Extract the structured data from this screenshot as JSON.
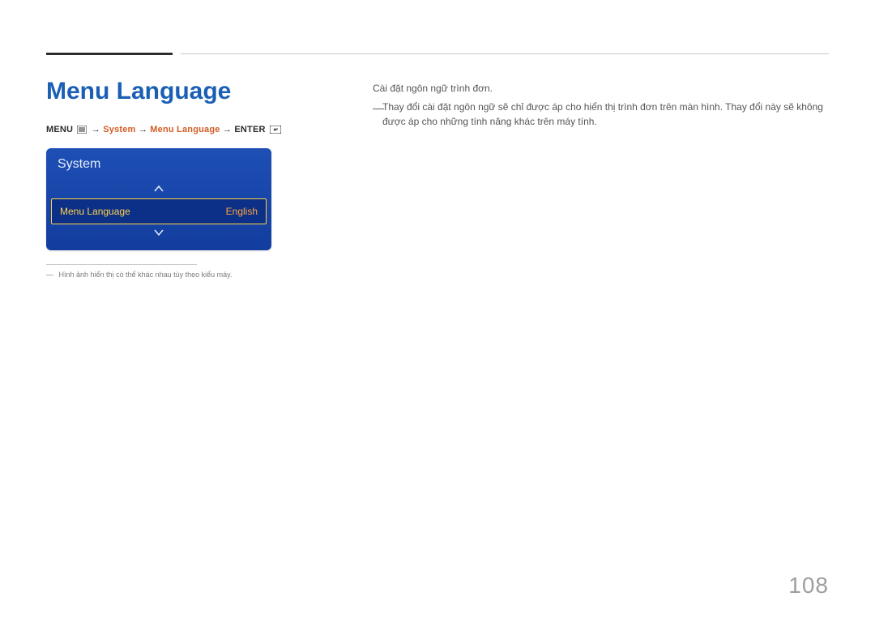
{
  "title": "Menu Language",
  "breadcrumb": {
    "menu": "MENU",
    "arrow": "→",
    "system": "System",
    "item": "Menu Language",
    "enter": "ENTER"
  },
  "description": {
    "line1": "Cài đặt ngôn ngữ trình đơn.",
    "note": "Thay đổi cài đặt ngôn ngữ sẽ chỉ được áp cho hiển thị trình đơn trên màn hình. Thay đổi này sẽ không được áp cho những tính năng khác trên máy tính."
  },
  "osd": {
    "title": "System",
    "item_label": "Menu Language",
    "item_value": "English"
  },
  "footnote": "Hình ảnh hiển thị có thể khác nhau tùy theo kiểu máy.",
  "page_number": "108"
}
